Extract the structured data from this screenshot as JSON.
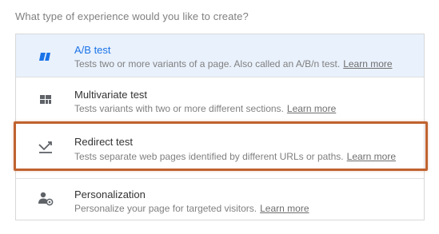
{
  "question": "What type of experience would you like to create?",
  "options": [
    {
      "icon": "ab-test-icon",
      "title": "A/B test",
      "description": "Tests two or more variants of a page. Also called an A/B/n test.",
      "link": "Learn more",
      "selected": true
    },
    {
      "icon": "multivariate-grid-icon",
      "title": "Multivariate test",
      "description": "Tests variants with two or more different sections.",
      "link": "Learn more",
      "selected": false
    },
    {
      "icon": "redirect-arrow-icon",
      "title": "Redirect test",
      "description": "Tests separate web pages identified by different URLs or paths.",
      "link": "Learn more",
      "selected": false
    },
    {
      "icon": "personalization-user-icon",
      "title": "Personalization",
      "description": "Personalize your page for targeted visitors.",
      "link": "Learn more",
      "selected": false
    }
  ],
  "colors": {
    "accent": "#1a73e8",
    "selected_bg": "#e9f1fc",
    "highlight_border": "#c0622f",
    "icon": "#5f6368"
  }
}
